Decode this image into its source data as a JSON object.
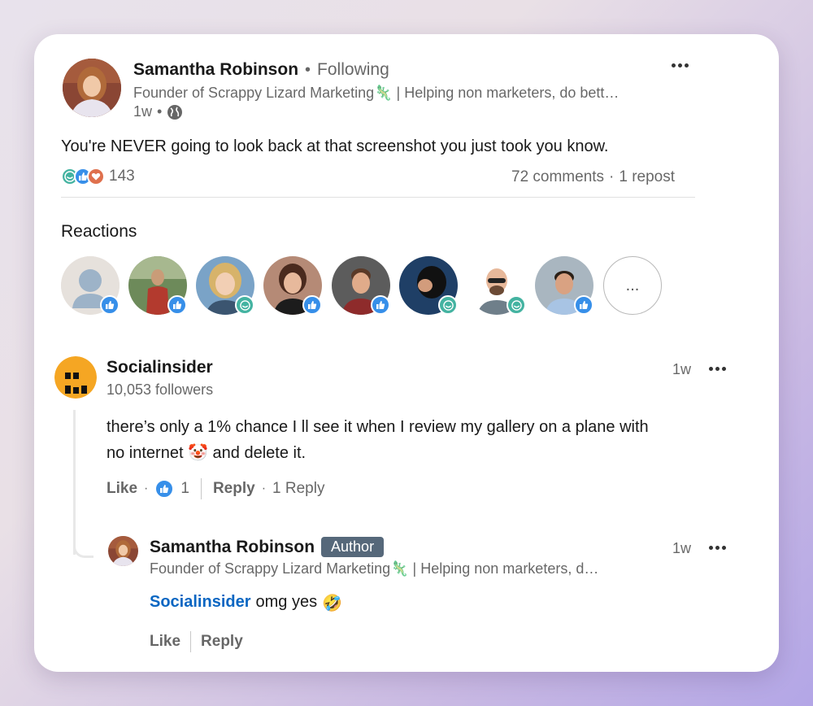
{
  "post": {
    "author": {
      "name": "Samantha Robinson",
      "follow_status": "Following",
      "headline": "Founder of Scrappy Lizard Marketing🦎 | Helping non marketers, do bett…",
      "time": "1w"
    },
    "text": "You're NEVER going to look back at that screenshot you just took you know.",
    "reaction_count": "143",
    "comments_label": "72 comments",
    "reposts_label": "1 repost",
    "reaction_icons": [
      "funny-icon",
      "like-icon",
      "love-icon"
    ]
  },
  "reactions": {
    "heading": "Reactions",
    "people": [
      {
        "icon": "default-avatar-icon",
        "reaction": "like"
      },
      {
        "icon": "person-avatar-icon",
        "reaction": "like"
      },
      {
        "icon": "person-avatar-icon",
        "reaction": "funny"
      },
      {
        "icon": "person-avatar-icon",
        "reaction": "like"
      },
      {
        "icon": "person-avatar-icon",
        "reaction": "like"
      },
      {
        "icon": "person-avatar-icon",
        "reaction": "funny"
      },
      {
        "icon": "person-avatar-icon",
        "reaction": "funny"
      },
      {
        "icon": "person-avatar-icon",
        "reaction": "like"
      }
    ],
    "more_label": "..."
  },
  "comment": {
    "author": "Socialinsider",
    "followers": "10,053 followers",
    "time": "1w",
    "text_line1": "there’s only a 1% chance I ll see it when I review my gallery on a plane with",
    "text_line2_before": "no internet",
    "text_line2_emoji": "🤡",
    "text_line2_after": "and delete it.",
    "like_label": "Like",
    "like_count": "1",
    "reply_label": "Reply",
    "replies_label": "1 Reply"
  },
  "reply": {
    "author": "Samantha Robinson",
    "author_badge": "Author",
    "headline": "Founder of Scrappy Lizard Marketing🦎 | Helping non marketers, d…",
    "time": "1w",
    "mention": "Socialinsider",
    "text": "omg yes",
    "emoji": "🤣",
    "like_label": "Like",
    "reply_label": "Reply"
  },
  "colors": {
    "like": "#378fe9",
    "love": "#df704d",
    "funny": "#44b3a1",
    "link": "#0a66c2",
    "author_badge": "#56687a",
    "socialinsider_brand": "#f5a623"
  }
}
